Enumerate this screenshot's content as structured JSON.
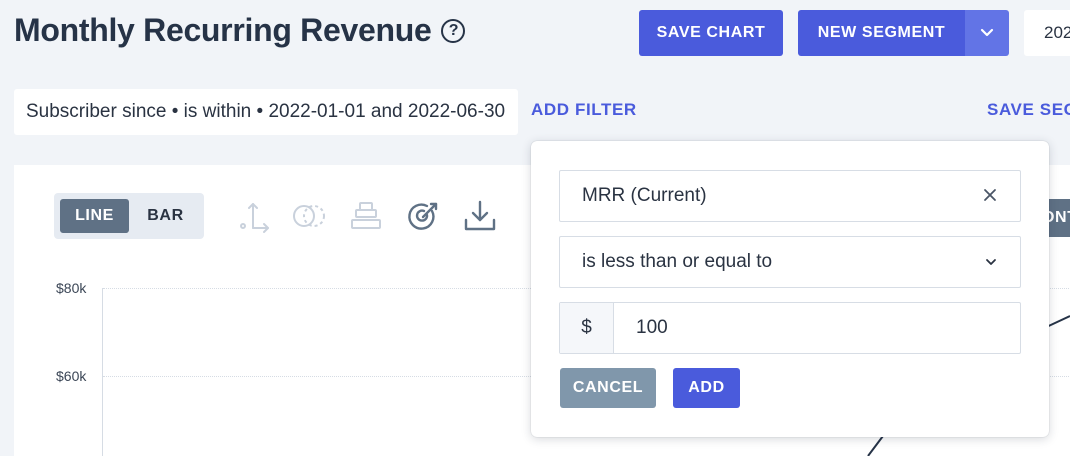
{
  "header": {
    "title": "Monthly Recurring Revenue",
    "help_glyph": "?",
    "save_chart_label": "SAVE CHART",
    "new_segment_label": "NEW SEGMENT",
    "date_range_partial": "202"
  },
  "filter_bar": {
    "active_filter": "Subscriber since • is within • 2022-01-01 and 2022-06-30",
    "add_filter_label": "ADD FILTER",
    "save_segment_label": "SAVE SEG"
  },
  "chart_toolbar": {
    "line_label": "LINE",
    "bar_label": "BAR",
    "active_view": "LINE",
    "edge_button_partial": "ONT",
    "icons": [
      "axis-icon",
      "compare-circles-icon",
      "stack-icon",
      "goal-target-icon",
      "download-icon"
    ]
  },
  "chart": {
    "y_ticks": [
      "$80k",
      "$60k"
    ]
  },
  "filter_popover": {
    "metric": "MRR (Current)",
    "operator": "is less than or equal to",
    "currency_symbol": "$",
    "value": "100",
    "cancel_label": "CANCEL",
    "add_label": "ADD"
  },
  "colors": {
    "primary": "#4a5bdc",
    "primary_light": "#6274e6",
    "slate": "#5f7185",
    "cancel": "#8097ab",
    "text": "#263347",
    "background": "#f1f4f8"
  }
}
